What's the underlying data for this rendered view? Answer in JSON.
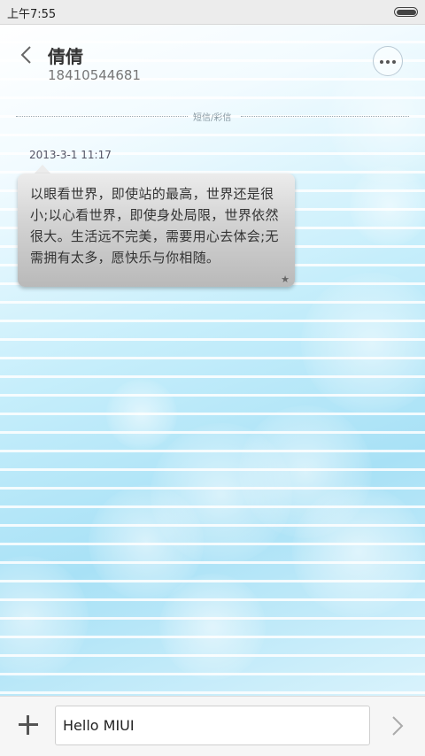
{
  "status_bar": {
    "time": "上午7:55"
  },
  "header": {
    "contact_name": "倩倩",
    "phone": "18410544681"
  },
  "conversation": {
    "divider_label": "短信/彩信",
    "messages": [
      {
        "time": "2013-3-1 11:17",
        "text": "以眼看世界，即使站的最高，世界还是很小;以心看世界，即使身处局限，世界依然很大。生活远不完美，需要用心去体会;无需拥有太多，愿快乐与你相随。"
      }
    ]
  },
  "composer": {
    "input_value": "Hello MIUI"
  },
  "colors": {
    "bubble_gray": "#c8c8c8",
    "background_blue": "#a8e1f6"
  }
}
